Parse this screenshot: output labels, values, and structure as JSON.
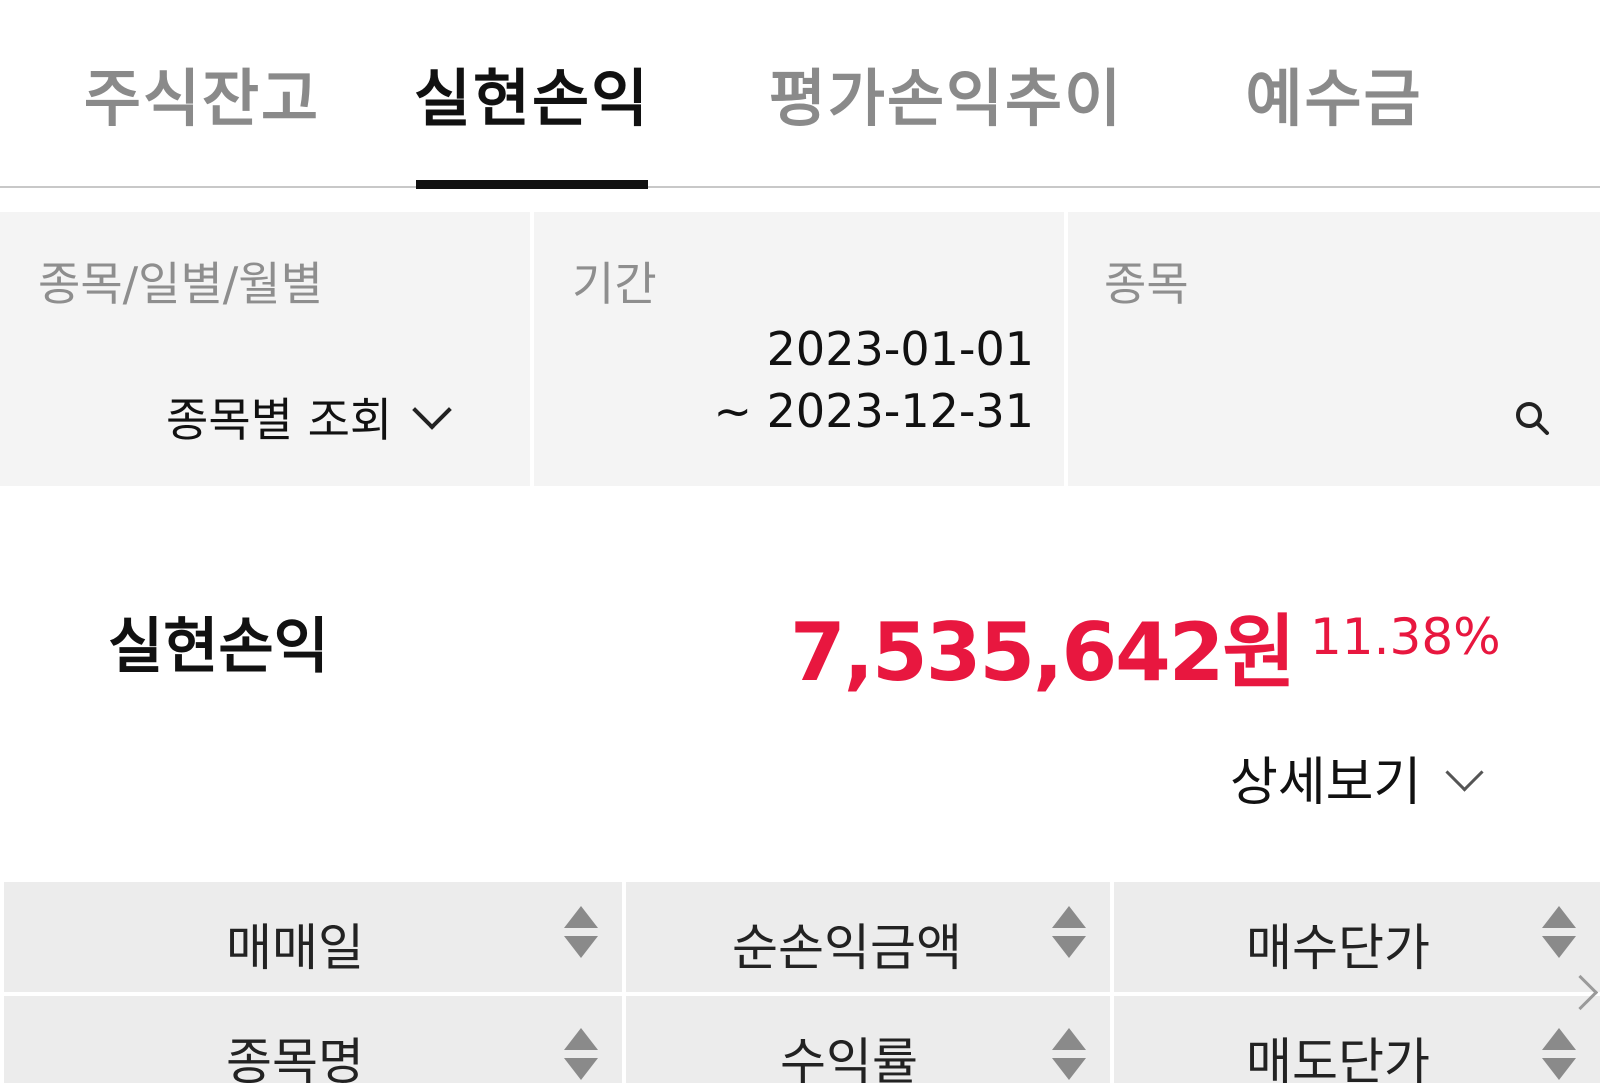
{
  "tabs": [
    {
      "label": "주식잔고"
    },
    {
      "label": "실현손익"
    },
    {
      "label": "평가손익추이"
    },
    {
      "label": "예수금"
    }
  ],
  "active_tab": "실현손익",
  "filters": {
    "view": {
      "label": "종목/일별/월별",
      "value": "종목별 조회"
    },
    "period": {
      "label": "기간",
      "start": "2023-01-01",
      "end": "~ 2023-12-31"
    },
    "stock": {
      "label": "종목",
      "value": ""
    }
  },
  "summary": {
    "label": "실현손익",
    "amount": "7,535,642원",
    "rate": "11.38%",
    "detail_label": "상세보기"
  },
  "table": {
    "headers_row1": [
      "매매일",
      "순손익금액",
      "매수단가"
    ],
    "headers_row2": [
      "종목명",
      "수익률",
      "매도단가"
    ]
  },
  "colors": {
    "profit": "#e8173f",
    "active_tab": "#111111",
    "inactive_tab": "#8a8a8a"
  },
  "icons": [
    "search-icon",
    "chevron-down-icon",
    "sort-icon",
    "chevron-right-icon"
  ]
}
